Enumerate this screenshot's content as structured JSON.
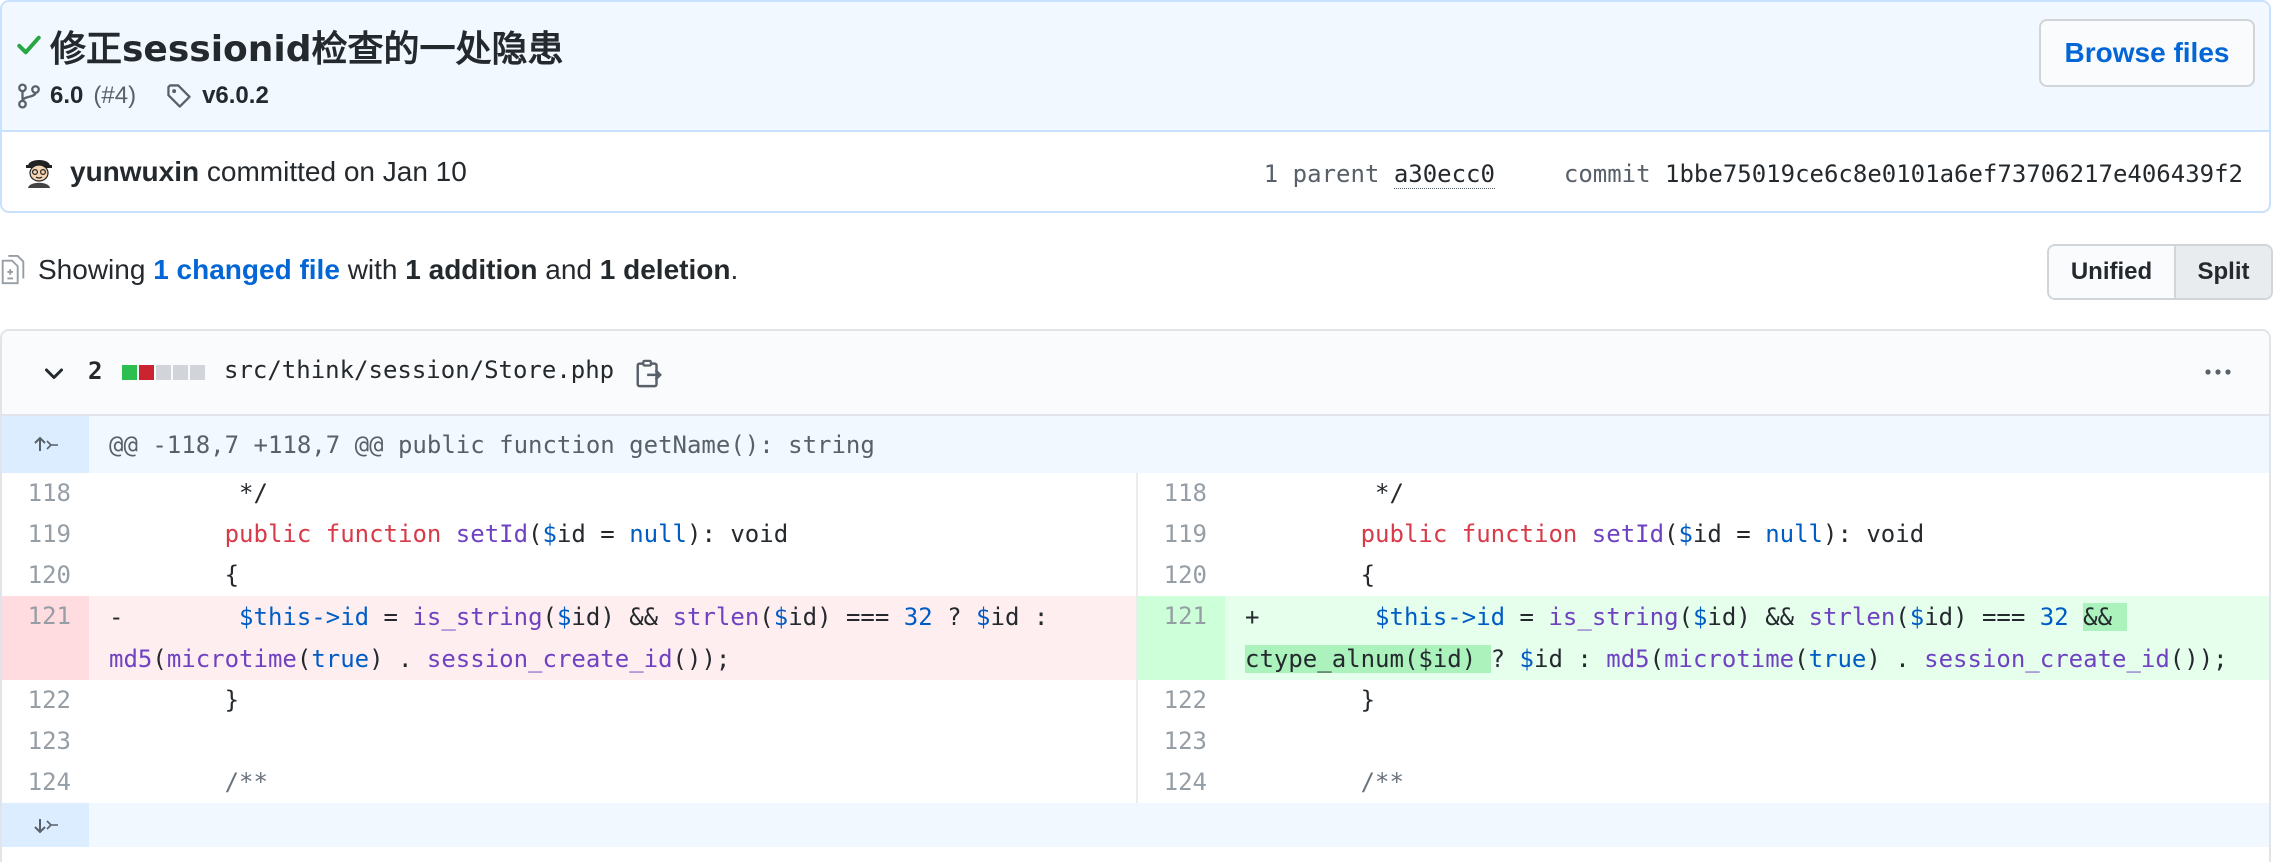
{
  "commit": {
    "title": "修正sessionid检查的一处隐患",
    "branch": "6.0",
    "pr_ref": "(#4)",
    "tag": "v6.0.2",
    "browse_files_label": "Browse files",
    "author": "yunwuxin",
    "committed_text": "committed on Jan 10",
    "parent_count_label": "1 parent",
    "parent_sha": "a30ecc0",
    "commit_label": "commit",
    "commit_sha": "1bbe75019ce6c8e0101a6ef73706217e406439f2"
  },
  "summary": {
    "showing": "Showing",
    "changed_files": "1 changed file",
    "with": "with",
    "additions": "1 addition",
    "and": "and",
    "deletions": "1 deletion",
    "period": "."
  },
  "view_toggle": {
    "unified_label": "Unified",
    "split_label": "Split",
    "selected": "Split"
  },
  "file": {
    "change_count": "2",
    "diffstat": [
      "green",
      "red",
      "gray",
      "gray",
      "gray"
    ],
    "path": "src/think/session/Store.php",
    "hunk_header": "@@ -118,7 +118,7 @@ public function getName(): string"
  },
  "colors": {
    "add_bg": "#e6ffed",
    "del_bg": "#ffeef0",
    "hunk_bg": "#f1f8ff",
    "link": "#0366d6",
    "check": "#28a745"
  },
  "diff": {
    "left": [
      {
        "num": "118",
        "type": "ctx"
      },
      {
        "num": "119",
        "type": "ctx"
      },
      {
        "num": "120",
        "type": "ctx"
      },
      {
        "num": "121",
        "type": "del"
      },
      {
        "num": "122",
        "type": "ctx"
      },
      {
        "num": "123",
        "type": "ctx"
      },
      {
        "num": "124",
        "type": "ctx"
      }
    ],
    "right": [
      {
        "num": "118",
        "type": "ctx"
      },
      {
        "num": "119",
        "type": "ctx"
      },
      {
        "num": "120",
        "type": "ctx"
      },
      {
        "num": "121",
        "type": "add"
      },
      {
        "num": "122",
        "type": "ctx"
      },
      {
        "num": "123",
        "type": "ctx"
      },
      {
        "num": "124",
        "type": "ctx"
      }
    ],
    "code": {
      "l118": "         */",
      "l119_indent": "        ",
      "l119_kw1": "public",
      "l119_kw2": "function",
      "l119_fn": "setId",
      "l119_open": "(",
      "l119_var": "$",
      "l119_id": "id = ",
      "l119_null": "null",
      "l119_rest": "): void",
      "l120": "        {",
      "del_sign": "-",
      "add_sign": "+",
      "l121_indent": "        ",
      "this": "$this->",
      "prop_id": "id",
      "eq": " = ",
      "is_string": "is_string",
      "arg_open": "(",
      "dollar": "$",
      "id_close": "id) && ",
      "strlen": "strlen",
      "id_cmp": "id) === ",
      "num32": "32",
      "tern": " ? ",
      "id_word": "id",
      "colon": " :",
      "md5": "md5",
      "microtime": "microtime",
      "true": "true",
      "concat": ") . ",
      "session_create_id": "session_create_id",
      "end": "());",
      "and_and": "&& ",
      "ctype_alnum": "ctype_alnum($id) ",
      "tern_q": "? ",
      "id_colon": "id : ",
      "l122": "        }",
      "l123": "",
      "l124": "        /**"
    }
  }
}
